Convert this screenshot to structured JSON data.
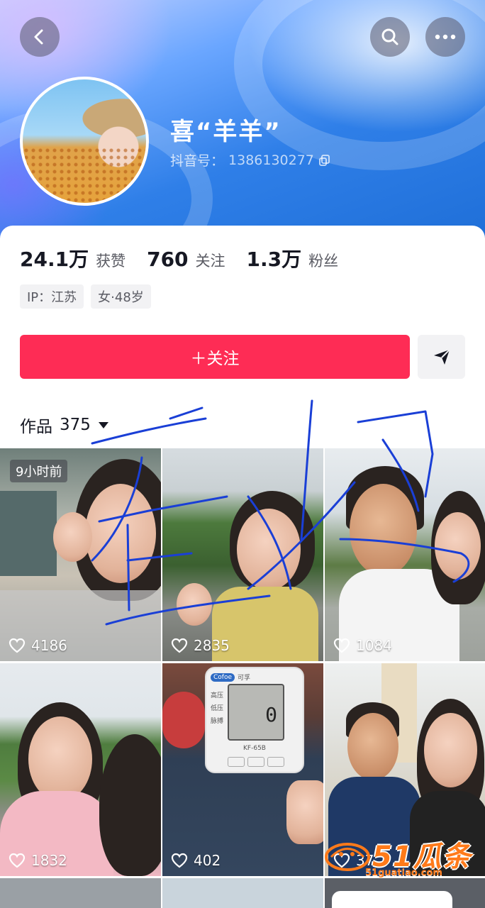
{
  "header": {
    "back_icon": "back-arrow-icon",
    "search_icon": "search-icon",
    "more_icon": "more-dots-icon"
  },
  "profile": {
    "name": "喜“羊羊”",
    "id_label": "抖音号：",
    "id_value": "1386130277",
    "copy_icon": "copy-icon"
  },
  "stats": [
    {
      "value": "24.1万",
      "label": "获赞"
    },
    {
      "value": "760",
      "label": "关注"
    },
    {
      "value": "1.3万",
      "label": "粉丝"
    }
  ],
  "tags": [
    "IP：江苏",
    "女·48岁"
  ],
  "actions": {
    "follow_label": "＋关注",
    "send_icon": "send-icon"
  },
  "works": {
    "label": "作品",
    "count": "375",
    "dropdown_icon": "caret-down-icon"
  },
  "videos": [
    {
      "likes": "4186",
      "badge": "9小时前"
    },
    {
      "likes": "2835"
    },
    {
      "likes": "1084"
    },
    {
      "likes": "1832"
    },
    {
      "likes": "402"
    },
    {
      "likes": "37"
    }
  ],
  "monitor": {
    "brand": "Cofoe",
    "brand_cn": "可孚",
    "model": "KF-65B",
    "reading": "0",
    "labels": [
      "高压",
      "低压",
      "脉搏"
    ]
  },
  "watermark": {
    "title": "51瓜条",
    "url": "51guatiao.com"
  },
  "colors": {
    "accent": "#fe2c55",
    "watermark": "#ff7a1a",
    "scribble": "#1a3fd6"
  }
}
